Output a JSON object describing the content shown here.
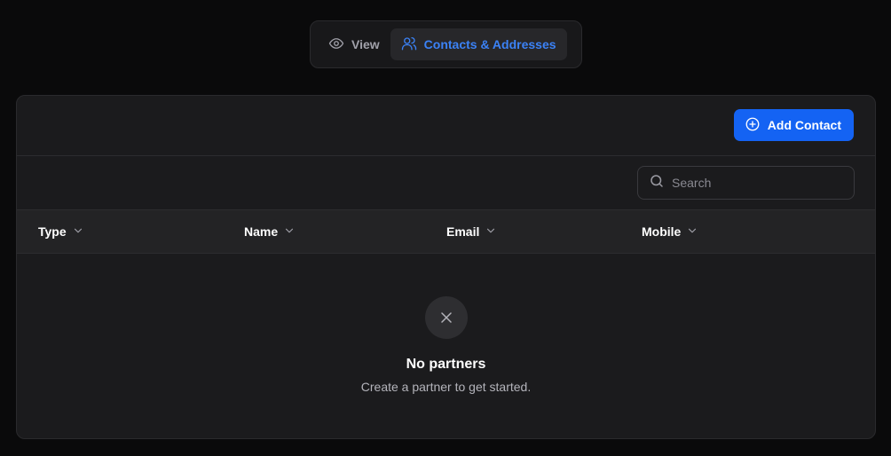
{
  "tabs": [
    {
      "label": "View",
      "icon": "eye-icon",
      "active": false
    },
    {
      "label": "Contacts & Addresses",
      "icon": "users-icon",
      "active": true
    }
  ],
  "toolbar": {
    "add_label": "Add Contact"
  },
  "search": {
    "placeholder": "Search",
    "value": ""
  },
  "table": {
    "columns": [
      "Type",
      "Name",
      "Email",
      "Mobile"
    ]
  },
  "empty_state": {
    "icon": "x-icon",
    "title": "No partners",
    "subtitle": "Create a partner to get started."
  },
  "colors": {
    "accent": "#1463f3",
    "active_tab": "#3b82f6",
    "background": "#0a0a0b",
    "card": "#1b1b1d"
  }
}
